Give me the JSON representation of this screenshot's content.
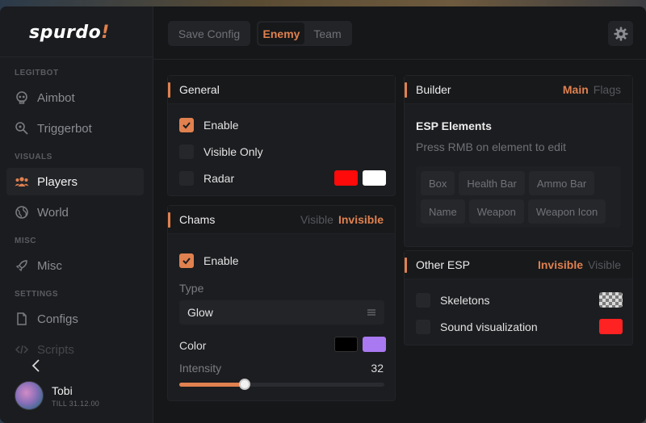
{
  "app": {
    "logo_main": "spurdo",
    "logo_accent": "!"
  },
  "sidebar": {
    "sections": {
      "legitbot": "LEGITBOT",
      "visuals": "VISUALS",
      "misc": "MISC",
      "settings": "SETTINGS"
    },
    "items": {
      "aimbot": "Aimbot",
      "triggerbot": "Triggerbot",
      "players": "Players",
      "world": "World",
      "misc": "Misc",
      "configs": "Configs",
      "scripts": "Scripts"
    },
    "active": "players"
  },
  "user": {
    "name": "Tobi",
    "till": "TILL 31.12.00"
  },
  "topbar": {
    "save_config": "Save Config",
    "tabs": [
      "Enemy",
      "Team"
    ],
    "active_tab": "Enemy"
  },
  "general": {
    "title": "General",
    "enable": "Enable",
    "visible_only": "Visible Only",
    "radar": "Radar",
    "radar_color_1": "#ff0a0a",
    "radar_color_2": "#ffffff"
  },
  "chams": {
    "title": "Chams",
    "tabs": [
      "Visible",
      "Invisible"
    ],
    "active_tab": "Invisible",
    "enable": "Enable",
    "type_label": "Type",
    "type_value": "Glow",
    "color_label": "Color",
    "color_1": "#000000",
    "color_2": "#a879f0",
    "intensity_label": "Intensity",
    "intensity_value": "32",
    "intensity_fraction": 0.32
  },
  "builder": {
    "title": "Builder",
    "tabs": [
      "Main",
      "Flags"
    ],
    "active_tab": "Main",
    "heading": "ESP Elements",
    "hint": "Press RMB on element to edit",
    "elements": [
      "Box",
      "Health Bar",
      "Ammo Bar",
      "Name",
      "Weapon",
      "Weapon Icon"
    ]
  },
  "other_esp": {
    "title": "Other ESP",
    "tabs": [
      "Invisible",
      "Visible"
    ],
    "active_tab": "Invisible",
    "skeletons": "Skeletons",
    "sound_visualization": "Sound visualization",
    "sound_color": "#ff2222"
  },
  "colors": {
    "accent": "#e0814f"
  }
}
